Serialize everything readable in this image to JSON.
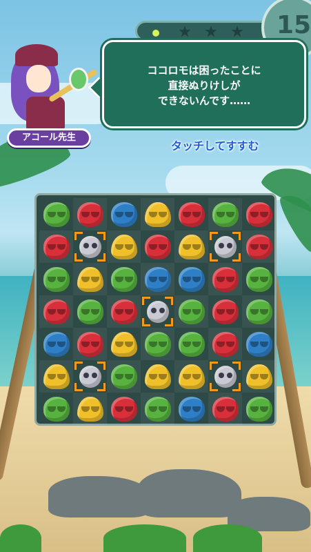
{
  "hud": {
    "remaining_moves": "15",
    "progress_stars": [
      "star-empty",
      "star-empty",
      "star-empty"
    ]
  },
  "character": {
    "name": "アコール先生"
  },
  "dialogue": {
    "text": "ココロモは困ったことに\n直接ぬりけしが\nできないんです……"
  },
  "tap_hint": "タッチしてすすむ",
  "board": {
    "columns": 7,
    "rows": [
      [
        "green",
        "red",
        "blue",
        "yellow",
        "red",
        "green",
        "red"
      ],
      [
        "red",
        "ojama-target",
        "yellow",
        "red",
        "yellow",
        "ojama-target",
        "red"
      ],
      [
        "green",
        "yellow",
        "green",
        "blue",
        "blue",
        "red",
        "green"
      ],
      [
        "red",
        "green",
        "red",
        "ojama-target",
        "green",
        "red",
        "green"
      ],
      [
        "blue",
        "red",
        "yellow",
        "green",
        "green",
        "red",
        "blue"
      ],
      [
        "yellow",
        "ojama-target",
        "green",
        "yellow",
        "yellow",
        "ojama-target",
        "yellow"
      ],
      [
        "green",
        "yellow",
        "red",
        "green",
        "blue",
        "red",
        "green"
      ]
    ]
  },
  "colors": {
    "red": "#d8303b",
    "green": "#57b23f",
    "blue": "#2e7fc6",
    "yellow": "#f0c02a",
    "ojama": "#c9c9d3",
    "target_frame": "#f39a1d",
    "bubble_bg": "#1f6f5a",
    "name_bg": "#6a3fa0",
    "hint_text": "#1d5fd0"
  }
}
